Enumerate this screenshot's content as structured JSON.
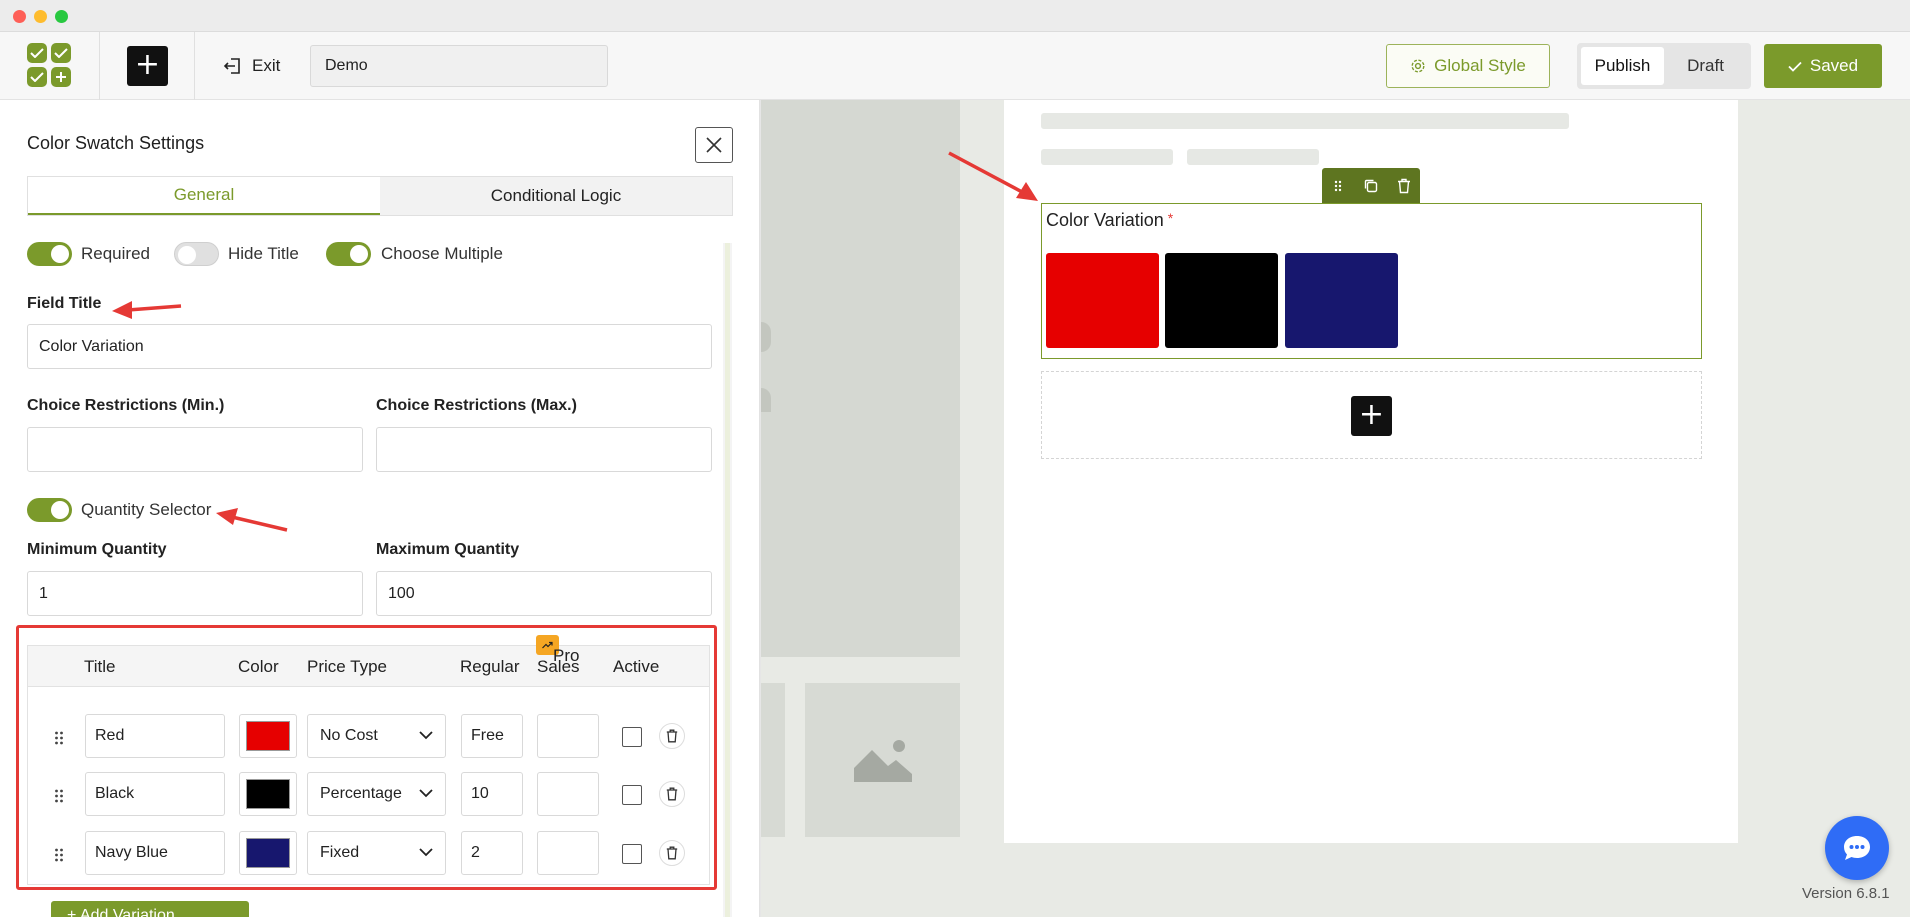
{
  "topbar": {
    "exit_label": "Exit",
    "page_name": "Demo",
    "global_style_label": "Global Style",
    "publish_label": "Publish",
    "draft_label": "Draft",
    "saved_label": "Saved"
  },
  "settings": {
    "title": "Color Swatch Settings",
    "tabs": [
      {
        "label": "General",
        "active": true
      },
      {
        "label": "Conditional Logic",
        "active": false
      }
    ],
    "toggles": {
      "required": {
        "label": "Required",
        "on": true
      },
      "hide_title": {
        "label": "Hide Title",
        "on": false
      },
      "choose_multiple": {
        "label": "Choose Multiple",
        "on": true
      },
      "quantity_selector": {
        "label": "Quantity Selector",
        "on": true
      }
    },
    "field_title": {
      "label": "Field Title",
      "value": "Color Variation"
    },
    "choice_min": {
      "label": "Choice Restrictions (Min.)",
      "value": ""
    },
    "choice_max": {
      "label": "Choice Restrictions (Max.)",
      "value": ""
    },
    "min_qty": {
      "label": "Minimum Quantity",
      "value": "1"
    },
    "max_qty": {
      "label": "Maximum Quantity",
      "value": "100"
    },
    "table": {
      "headers": {
        "title": "Title",
        "color": "Color",
        "price_type": "Price Type",
        "regular": "Regular",
        "sales": "Sales",
        "active": "Active"
      },
      "pro_badge": "Pro",
      "rows": [
        {
          "title": "Red",
          "color": "#e60000",
          "price_type": "No Cost",
          "regular": "Free",
          "sales": "",
          "active": false
        },
        {
          "title": "Black",
          "color": "#000000",
          "price_type": "Percentage",
          "regular": "10",
          "sales": "",
          "active": false
        },
        {
          "title": "Navy Blue",
          "color": "#17176e",
          "price_type": "Fixed",
          "regular": "2",
          "sales": "",
          "active": false
        }
      ]
    },
    "add_variation_label": "+ Add Variation"
  },
  "preview": {
    "widget_title": "Color Variation",
    "required_mark": "*",
    "swatches": [
      "#e60000",
      "#000000",
      "#17176e"
    ]
  },
  "version": "Version 6.8.1",
  "colors": {
    "accent": "#7b9a2b",
    "highlight": "#e53935",
    "chat": "#2f6cf6"
  }
}
